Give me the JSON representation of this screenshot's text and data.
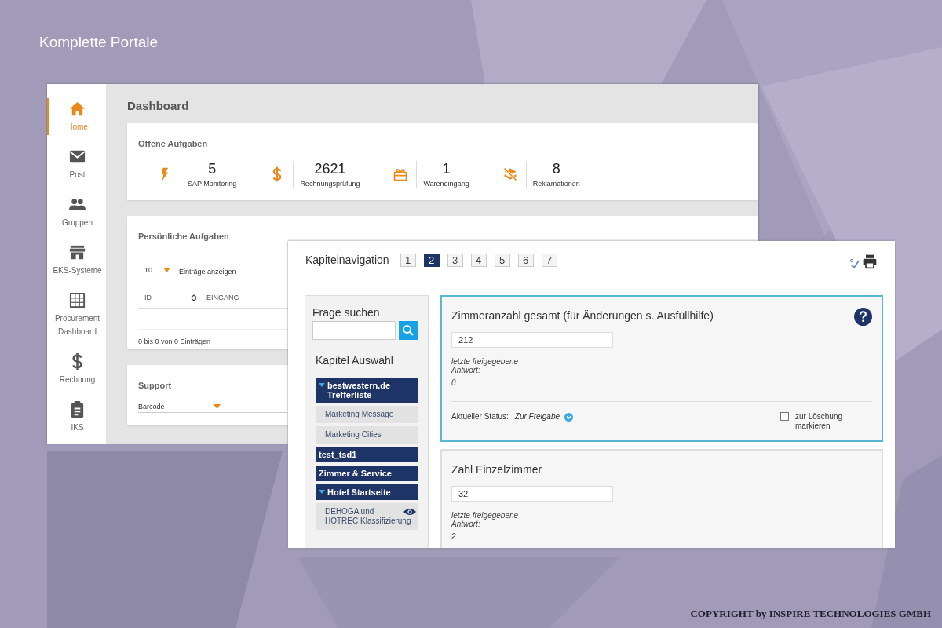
{
  "slide_title": "Komplette Portale",
  "dashboard": {
    "sidebar": [
      {
        "label": "Home",
        "selected": true
      },
      {
        "label": "Post",
        "selected": false
      },
      {
        "label": "Gruppen",
        "selected": false
      },
      {
        "label": "EKS-Systeme",
        "selected": false
      },
      {
        "label": "Procurement Dashboard",
        "selected": false
      },
      {
        "label": "Rechnung",
        "selected": false
      },
      {
        "label": "IKS",
        "selected": false
      }
    ],
    "title": "Dashboard",
    "open_tasks": {
      "title": "Offene Aufgaben",
      "stats": [
        {
          "value": "5",
          "label": "SAP Monitoring"
        },
        {
          "value": "2621",
          "label": "Rechnungsprüfung"
        },
        {
          "value": "1",
          "label": "Wareneingang"
        },
        {
          "value": "8",
          "label": "Reklamationen"
        }
      ]
    },
    "personal_tasks": {
      "title": "Persönliche Aufgaben",
      "page_size": "10",
      "page_size_label": "Einträge anzeigen",
      "columns": [
        "ID",
        "EINGANG"
      ],
      "info": "0 bis 0 von 0 Einträgen"
    },
    "support": {
      "title": "Support",
      "field_label": "Barcode",
      "field_value": "-"
    }
  },
  "questionnaire": {
    "title": "Kapitelnavigation",
    "pages": [
      {
        "label": "1",
        "selected": false
      },
      {
        "label": "2",
        "selected": true
      },
      {
        "label": "3",
        "selected": false
      },
      {
        "label": "4",
        "selected": false
      },
      {
        "label": "5",
        "selected": false
      },
      {
        "label": "6",
        "selected": false
      },
      {
        "label": "7",
        "selected": false
      }
    ],
    "search_label": "Frage suchen",
    "chapters_title": "Kapitel Auswahl",
    "chapters": [
      {
        "label": "bestwestern.de Trefferliste",
        "expanded": true,
        "children": [
          {
            "label": "Marketing Message",
            "preview": false
          },
          {
            "label": "Marketing Cities",
            "preview": false
          }
        ]
      },
      {
        "label": "test_tsd1",
        "expanded": false
      },
      {
        "label": "Zimmer & Service",
        "expanded": false
      },
      {
        "label": "Hotel Startseite",
        "expanded": true,
        "children": [
          {
            "label": "DEHOGA und HOTREC Klassifizierung",
            "preview": true
          }
        ]
      }
    ],
    "questions": [
      {
        "title": "Zimmeranzahl gesamt (für Änderungen s. Ausfüllhilfe)",
        "selected": true,
        "value": "212",
        "last_label": "letzte freigegebene Antwort:",
        "last_value": "0",
        "status_label": "Aktueller Status:",
        "status": "Zur Freigabe",
        "delete_label": "zur Löschung markieren",
        "delete_checked": false
      },
      {
        "title": "Zahl Einzelzimmer",
        "selected": false,
        "value": "32",
        "last_label": "letzte freigegebene Antwort:",
        "last_value": "2"
      }
    ]
  },
  "copyright": "COPYRIGHT by INSPIRE TECHNOLOGIES GMBH"
}
